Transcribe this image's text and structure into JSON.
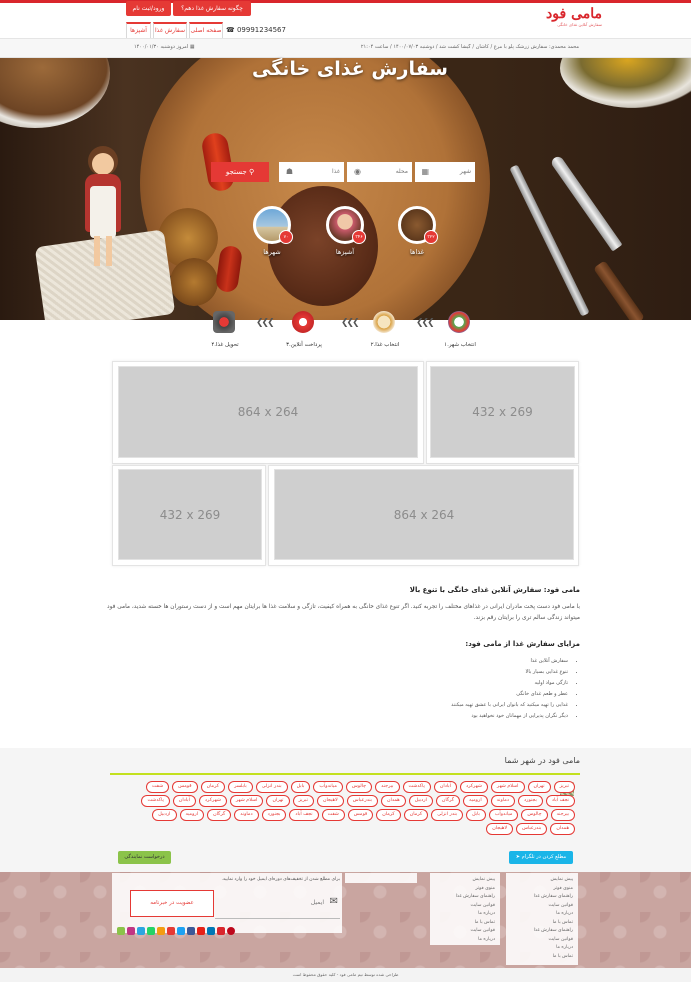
{
  "header": {
    "logo_text": "مامی فود",
    "logo_tagline": "سفارش آنلاین غذای خانگی",
    "phone": "09991234567",
    "how_to_order": "چگونه سفارش غذا دهم؟",
    "login": "ورود/ثبت نام",
    "tabs": [
      "صفحه اصلی",
      "سفارش غذا",
      "آشپزها"
    ],
    "breadcrumb": "محمد محمدی: سفارش زرشک پلو با مرغ / کاشان / گیشا کشت شد / دوشنبه ۱۴۰۰/۰۷/۰۳ / ساعت ۲۱:۰۴",
    "today": "امروز دوشنبه ۱۴۰۰/۰۱/۳۰"
  },
  "hero": {
    "title": "سفارش غذای خانگی",
    "search": {
      "city_placeholder": "شهر",
      "area_placeholder": "محله",
      "food_placeholder": "غذا",
      "button": "جستجو"
    },
    "stats": [
      {
        "label": "غذاها",
        "count": "۳۲۲"
      },
      {
        "label": "آشپزها",
        "count": "۳۴۶"
      },
      {
        "label": "شهرها",
        "count": "۷۰"
      }
    ]
  },
  "steps": [
    "۱.انتخاب شهر",
    "۲.انتخاب غذا",
    "۳.پرداخت آنلاین",
    "۴.تحویل غذا"
  ],
  "banners": [
    "864 x 264",
    "432 x 269",
    "432 x 269",
    "864 x 264"
  ],
  "article": {
    "title": "مامی فود: سفارش آنلاین غذای خانگی با تنوع بالا",
    "body": "با مامی فود دست پخت مادران ایرانی در غذاهای مختلف را تجربه کنید. اگر تنوع غذای خانگی به همراه کیفیت، تازگی و سلامت غذا ها برایتان مهم است و از دست رستوران ها خسته شدید، مامی فود میتواند زندگی سالم تری را برایتان رقم بزند.",
    "features_title": "مزایای سفارش غذا از مامی فود:",
    "features": [
      "سفارش آنلاین غذا",
      "تنوع غذایی بسیار بالا",
      "تازگی مواد اولیه",
      "عطر و طعم غذای خانگی",
      "غذایی را تهیه میکنید که بانوان ایرانی با عشق تهیه میکنند",
      "دیگر نگران پذیرایی از مهمانان خود نخواهید بود"
    ]
  },
  "cities_section": {
    "title": "مامی فود در شهر شما",
    "cities": [
      "تبریز",
      "تهران",
      "اسلام شهر",
      "شهرکرد",
      "آبادان",
      "پاکدشت",
      "بیرجند",
      "چالوس",
      "میاندوآب",
      "بابل",
      "بندر انزلی",
      "بابلسر",
      "کرمان",
      "قومس",
      "شفت",
      "نجف آباد",
      "بجنورد",
      "دماوند",
      "ارومیه",
      "گرگان",
      "اردبیل",
      "همدان",
      "بندرعباس",
      "لاهیجان",
      "تبریز",
      "تهران",
      "اسلام شهر",
      "شهرکرد",
      "آبادان",
      "پاکدشت",
      "بیرجند",
      "چالوس",
      "میاندوآب",
      "بابل",
      "بندر انزلی",
      "کرمان",
      "کرمان",
      "قومس",
      "شفت",
      "نجف آباد",
      "بجنورد",
      "دماوند",
      "گرگان",
      "ارومیه",
      "اردبیل",
      "همدان",
      "بندرعباس",
      "لاهیجان"
    ],
    "telegram_button": "مطلع کردن در تلگرام",
    "agent_button": "درخواست نمایندگی"
  },
  "footer": {
    "col1": [
      "پیش نمایش",
      "منوی فوتر",
      "راهنمای سفارش غذا",
      "قوانین سایت",
      "درباره ما",
      "تماس با ما"
    ],
    "col2": [
      "پیش نمایش",
      "منوی فوتر",
      "راهنمای سفارش غذا",
      "قوانین سایت",
      "درباره ما",
      "تماس با ما"
    ],
    "newsletter_text": "برای مطلع شدن از تخفیف‌های دوره‌ای ایمیل خود را وارد نمایید.",
    "email_placeholder": "ایمیل",
    "subscribe_button": "عضویت در خبرنامه",
    "copyright": "طراحی شده توسط تیم مامی فود - کلیه حقوق محفوظ است"
  }
}
